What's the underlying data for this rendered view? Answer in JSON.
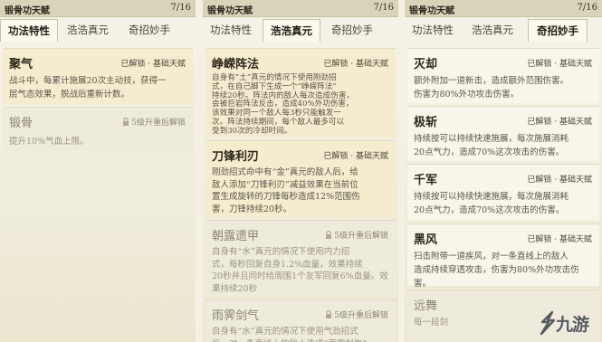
{
  "panels": [
    {
      "title": "锻骨功天赋",
      "count": "7/16",
      "tabs": [
        "功法特性",
        "浩浩真元",
        "奇招妙手"
      ],
      "active_tab": 0,
      "cards": [
        {
          "title": "聚气",
          "status": "已解锁 · 基础天赋",
          "locked": false,
          "active": true,
          "desc": "战斗中，每累计施展20次主动技，获得一\n层气态效果，脱战后重新计数。"
        },
        {
          "title": "锻骨",
          "status": "5级升重后解锁",
          "locked": true,
          "active": false,
          "desc": "提升10%气血上限。"
        }
      ]
    },
    {
      "title": "锻骨功天赋",
      "count": "7/16",
      "tabs": [
        "功法特性",
        "浩浩真元",
        "奇招妙手"
      ],
      "active_tab": 1,
      "cards": [
        {
          "title": "峥嵘阵法",
          "status": "已解锁 · 基础天赋",
          "locked": false,
          "active": true,
          "desc": "自身有“土”真元的情况下使用刚劲招\n式，在自己脚下生成一个“峥嵘阵法”\n持续20秒。阵法内的敌人每次造成伤害，\n会被巨岩阵法反击，造成40%外功伤害，\n该效果对同一个敌人每3秒只能触发一\n次。阵法持续期间，每个敌人最多可以\n受到30次的冷却时间。"
        },
        {
          "title": "刀锋利刃",
          "status": "已解锁 · 基础天赋",
          "locked": false,
          "active": true,
          "desc": "刚劲招式命中有“金”真元的敌人后，给\n敌人添加“刀锋利刃”减益效果在当前位\n置生成旋转的刀锋每秒造成12%范围伤\n害，刀锋持续20秒。"
        },
        {
          "title": "朝露遗甲",
          "status": "5级升重后解锁",
          "locked": true,
          "active": false,
          "desc": "自身有“水”真元的情况下使用内力招\n式，每秒回复自身1.2%血量，效果持续\n20秒并且同时给周围1个友军回复6%血量。效果持续20秒"
        },
        {
          "title": "雨霁剑气",
          "status": "5级升重后解锁",
          "locked": true,
          "active": false,
          "desc": "自身有“水”真元的情况下使用气劲招式\n后，对一条直线上的敌人造成“雨霁剑气”"
        }
      ]
    },
    {
      "title": "锻骨功天赋",
      "count": "7/16",
      "tabs": [
        "功法特性",
        "浩浩真元",
        "奇招妙手"
      ],
      "active_tab": 2,
      "cards": [
        {
          "title": "灭却",
          "status": "已解锁 · 基础天赋",
          "locked": false,
          "active": false,
          "desc": "额外附加一道新击，造成额外范围伤害。\n伤害为80%外功攻击伤害。"
        },
        {
          "title": "极斩",
          "status": "已解锁 · 基础天赋",
          "locked": false,
          "active": false,
          "desc": "持续按可以持续快速施展，每次施展消耗\n20点气力，造成70%这次攻击的伤害。"
        },
        {
          "title": "千军",
          "status": "已解锁 · 基础天赋",
          "locked": false,
          "active": false,
          "desc": "持续按可以持续快速施展，每次施展消耗\n20点气力，造成70%这次攻击的伤害。"
        },
        {
          "title": "黑风",
          "status": "已解锁 · 基础天赋",
          "locked": false,
          "active": false,
          "desc": "扫击附带一道疾风，对一条直线上的敌人\n造成持续穿透攻击，伤害为80%外功攻击伤\n害。"
        },
        {
          "title": "远舞",
          "status": "",
          "locked": true,
          "active": false,
          "desc": "每一段剑"
        }
      ]
    }
  ],
  "watermark": {
    "text": "九游",
    "color": "#565a62"
  }
}
